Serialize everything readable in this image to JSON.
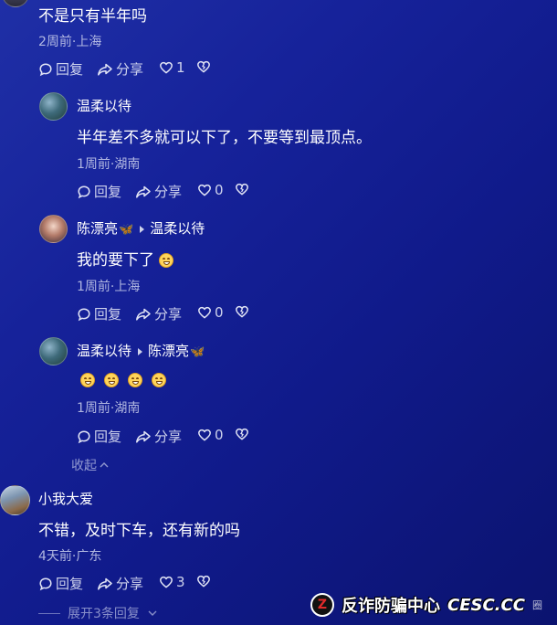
{
  "comments": [
    {
      "content": "不是只有半年吗",
      "meta": "2周前·上海",
      "reply_label": "回复",
      "share_label": "分享",
      "likes": "1"
    },
    {
      "author": "温柔以待",
      "content": "半年差不多就可以下了，不要等到最顶点。",
      "meta": "1周前·湖南",
      "reply_label": "回复",
      "share_label": "分享",
      "likes": "0"
    },
    {
      "author": "陈漂亮",
      "reply_to": "温柔以待",
      "content": "我的要下了",
      "meta": "1周前·上海",
      "reply_label": "回复",
      "share_label": "分享",
      "likes": "0"
    },
    {
      "author": "温柔以待",
      "reply_to": "陈漂亮",
      "meta": "1周前·湖南",
      "reply_label": "回复",
      "share_label": "分享",
      "likes": "0"
    },
    {
      "author": "小我大爱",
      "content": "不错，及时下车，还有新的吗",
      "meta": "4天前·广东",
      "reply_label": "回复",
      "share_label": "分享",
      "likes": "3"
    }
  ],
  "collapse_label": "收起",
  "expand_label": "展开3条回复",
  "watermark": {
    "text": "反诈防骗中心",
    "site": "CESC.CC",
    "suffix": "圈",
    "logo": "Z"
  },
  "icons": {
    "reply": "speech-bubble-icon",
    "share": "share-arrow-icon",
    "like": "heart-icon",
    "dislike": "broken-heart-icon",
    "butterfly": "butterfly-icon",
    "emoji": "grin-emoji-icon"
  },
  "colors": {
    "background_top": "#1f2fa6",
    "background_bottom": "#0b136f",
    "butterfly": "#7fc8ff"
  }
}
